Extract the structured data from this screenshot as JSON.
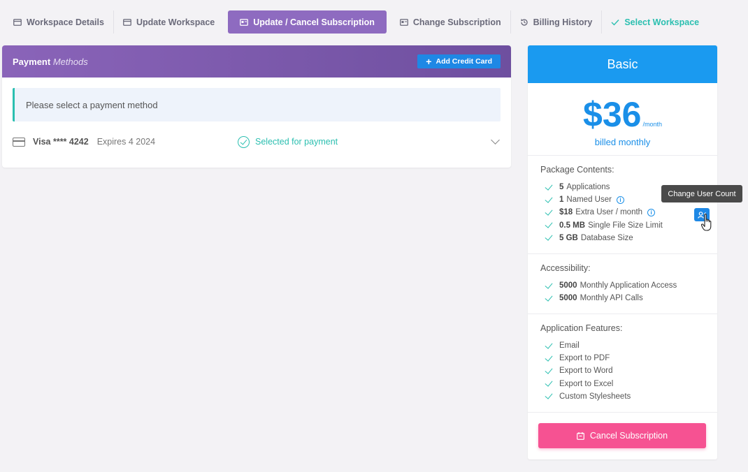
{
  "tabs": [
    {
      "label": "Workspace Details",
      "icon": "calendar-icon"
    },
    {
      "label": "Update Workspace",
      "icon": "calendar-icon"
    },
    {
      "label": "Update / Cancel Subscription",
      "icon": "id-card-icon"
    },
    {
      "label": "Change Subscription",
      "icon": "id-card-icon"
    },
    {
      "label": "Billing History",
      "icon": "history-icon"
    },
    {
      "label": "Select Workspace",
      "icon": "check-icon"
    }
  ],
  "payment": {
    "title_bold": "Payment",
    "title_italic": "Methods",
    "add_button": "Add Credit Card",
    "prompt": "Please select a payment method",
    "method_name": "Visa **** 4242",
    "method_expiry": "Expires 4 2024",
    "selected_text": "Selected for payment"
  },
  "plan": {
    "name": "Basic",
    "price": "$36",
    "per": "/month",
    "billed": "billed monthly",
    "package_title": "Package Contents:",
    "package": [
      {
        "bold": "5",
        "text": "Applications"
      },
      {
        "bold": "1",
        "text": "Named User"
      },
      {
        "bold": "$18",
        "text": "Extra User / month"
      },
      {
        "bold": "0.5 MB",
        "text": "Single File Size Limit"
      },
      {
        "bold": "5 GB",
        "text": "Database Size"
      }
    ],
    "access_title": "Accessibility:",
    "access": [
      {
        "bold": "5000",
        "text": "Monthly Application Access"
      },
      {
        "bold": "5000",
        "text": "Monthly API Calls"
      }
    ],
    "features_title": "Application Features:",
    "features": [
      "Email",
      "Export to PDF",
      "Export to Word",
      "Export to Excel",
      "Custom Stylesheets"
    ],
    "cancel_button": "Cancel Subscription"
  },
  "tooltip": "Change User Count",
  "colors": {
    "accent_purple": "#8e6bc0",
    "plan_blue": "#1a9af0",
    "teal": "#2bbfb0",
    "pink": "#f65292"
  }
}
